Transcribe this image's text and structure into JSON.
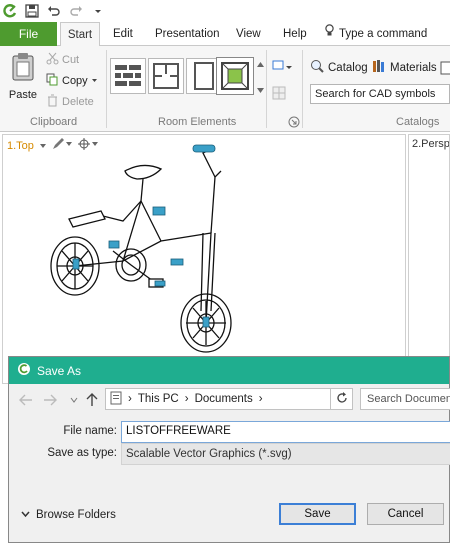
{
  "ribbon": {
    "tabs": {
      "file": "File",
      "start": "Start",
      "edit": "Edit",
      "presentation": "Presentation",
      "view": "View",
      "help": "Help",
      "command": "Type a command"
    },
    "clipboard": {
      "paste": "Paste",
      "cut": "Cut",
      "copy": "Copy",
      "delete": "Delete",
      "label": "Clipboard"
    },
    "room_elements": {
      "label": "Room Elements"
    },
    "catalogs": {
      "catalog": "Catalog",
      "materials": "Materials",
      "search_placeholder": "Search for CAD symbols",
      "label": "Catalogs"
    }
  },
  "views": {
    "top_label": "1.Top",
    "perspective_label": "2.Perspe"
  },
  "dialog": {
    "title": "Save As",
    "path": [
      "This PC",
      "Documents"
    ],
    "search_placeholder": "Search Documents",
    "file_name_label": "File name:",
    "file_name_value": "LISTOFFREEWARE",
    "save_type_label": "Save as type:",
    "save_type_value": "Scalable Vector Graphics (*.svg)",
    "browse_folders": "Browse Folders",
    "save_button": "Save",
    "cancel_button": "Cancel"
  },
  "colors": {
    "file_tab": "#4e9b2f",
    "dialog_title": "#1fae8f",
    "view_label": "#d68a00",
    "bike_accent": "#3aa0c8"
  }
}
